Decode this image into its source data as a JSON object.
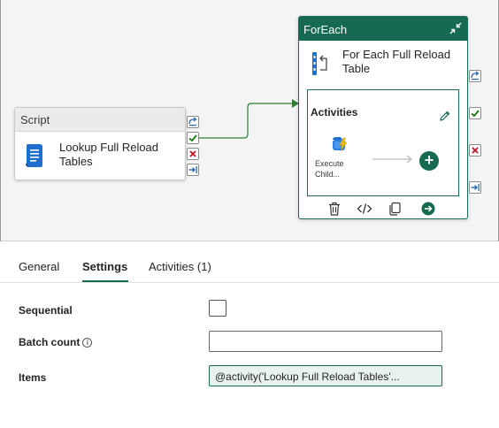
{
  "canvas": {
    "script_activity": {
      "type_label": "Script",
      "name": "Lookup Full Reload Tables"
    },
    "foreach_activity": {
      "type_label": "ForEach",
      "name": "For Each Full Reload Table",
      "inner_label": "Activities",
      "child_activity_label": "Execute Child..."
    }
  },
  "properties": {
    "tabs": [
      {
        "label": "General"
      },
      {
        "label": "Settings"
      },
      {
        "label": "Activities (1)"
      }
    ],
    "active_tab": "Settings",
    "fields": {
      "sequential_label": "Sequential",
      "batch_count_label": "Batch count",
      "batch_count_value": "",
      "items_label": "Items",
      "items_value": "@activity('Lookup Full Reload Tables'..."
    }
  },
  "colors": {
    "accent": "#166a52",
    "success": "#107c10",
    "failure": "#c50f1f",
    "canvas_bg": "#f4f4f4"
  },
  "icons": [
    "script-icon",
    "foreach-icon",
    "collapse-icon",
    "edit-icon",
    "execute-pipeline-icon",
    "add-icon",
    "delete-icon",
    "code-icon",
    "copy-icon",
    "go-icon",
    "skip-icon",
    "success-icon",
    "fail-icon",
    "completion-icon",
    "info-icon"
  ]
}
